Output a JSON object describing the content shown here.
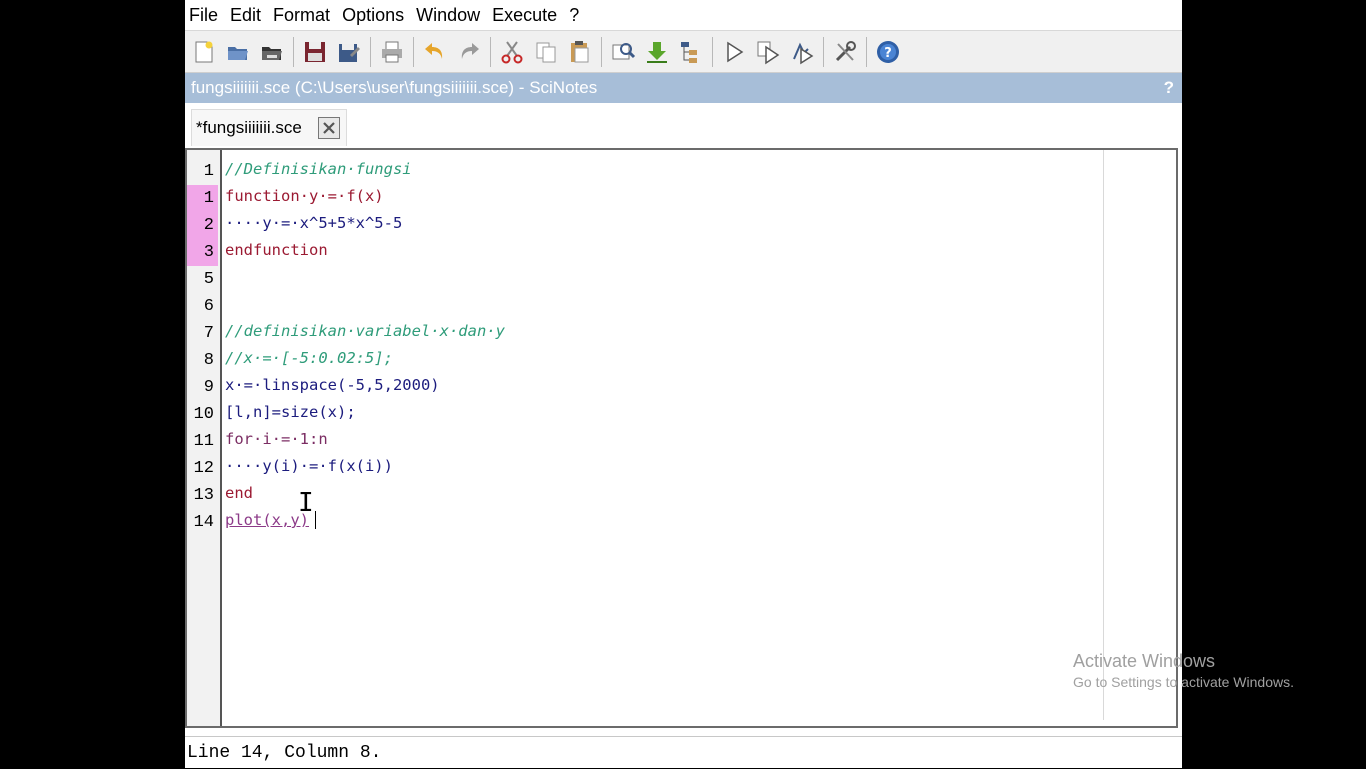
{
  "menu": [
    "File",
    "Edit",
    "Format",
    "Options",
    "Window",
    "Execute",
    "?"
  ],
  "toolbar": [
    "new-file-icon",
    "open-file-icon",
    "open-file-black-icon",
    "save-icon",
    "save-as-icon",
    "print-icon",
    "undo-icon",
    "redo-icon",
    "cut-icon",
    "copy-icon",
    "paste-icon",
    "find-icon",
    "load-into-scilab-icon",
    "file-tree-icon",
    "execute-icon",
    "execute-file-icon",
    "execute-selection-icon",
    "preferences-icon",
    "help-icon"
  ],
  "title": "fungsiiiiiii.sce (C:\\Users\\user\\fungsiiiiiii.sce) - SciNotes",
  "title_help": "?",
  "tab": {
    "label": "*fungsiiiiiii.sce"
  },
  "line_numbers": [
    "1",
    "1",
    "2",
    "3",
    "5",
    "6",
    "7",
    "8",
    "9",
    "10",
    "11",
    "12",
    "13",
    "14"
  ],
  "code_lines": [
    "//Definisikan·fungsi",
    "function·y·=·f(x)",
    "····y·=·x^5+5*x^5-5",
    "endfunction",
    "",
    "",
    "//definisikan·variabel·x·dan·y",
    "//x·=·[-5:0.02:5];",
    "x·=·linspace(-5,5,2000)",
    "[l,n]=size(x);",
    "for·i·=·1:n",
    "····y(i)·=·f(x(i))",
    "end",
    "plot(x,y)"
  ],
  "status": "Line 14, Column 8.",
  "watermark": {
    "line1": "Activate Windows",
    "line2": "Go to Settings to activate Windows."
  },
  "colors": {
    "title_bar": "#a7bed8",
    "modified_line": "#f1a6e8",
    "comment": "#2f9c7a",
    "keyword": "#9b1a32"
  }
}
